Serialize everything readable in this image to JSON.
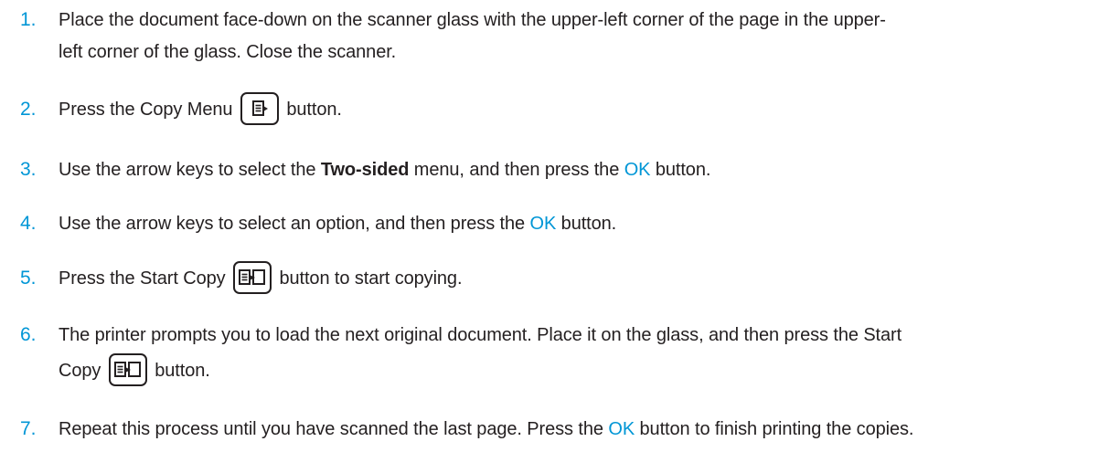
{
  "steps": [
    {
      "number": "1.",
      "line1": "Place the document face-down on the scanner glass with the upper-left corner of the page in the upper-",
      "line2": "left corner of the glass. Close the scanner."
    },
    {
      "number": "2.",
      "before": "Press the Copy Menu",
      "after": "button.",
      "icon": "copy-menu-icon"
    },
    {
      "number": "3.",
      "before": "Use the arrow keys to select the ",
      "bold": "Two-sided",
      "middle": " menu, and then press the ",
      "accent": "OK",
      "after": " button."
    },
    {
      "number": "4.",
      "before": "Use the arrow keys to select an option, and then press the ",
      "accent": "OK",
      "after": " button."
    },
    {
      "number": "5.",
      "before": "Press the Start Copy",
      "after": "button to start copying.",
      "icon": "start-copy-icon"
    },
    {
      "number": "6.",
      "line1": "The printer prompts you to load the next original document. Place it on the glass, and then press the Start",
      "line2_before": "Copy",
      "line2_after": "button.",
      "icon": "start-copy-icon"
    },
    {
      "number": "7.",
      "before": "Repeat this process until you have scanned the last page. Press the ",
      "accent": "OK",
      "after": " button to finish printing the copies."
    }
  ],
  "colors": {
    "accent": "#0096d6",
    "text": "#231f20"
  }
}
